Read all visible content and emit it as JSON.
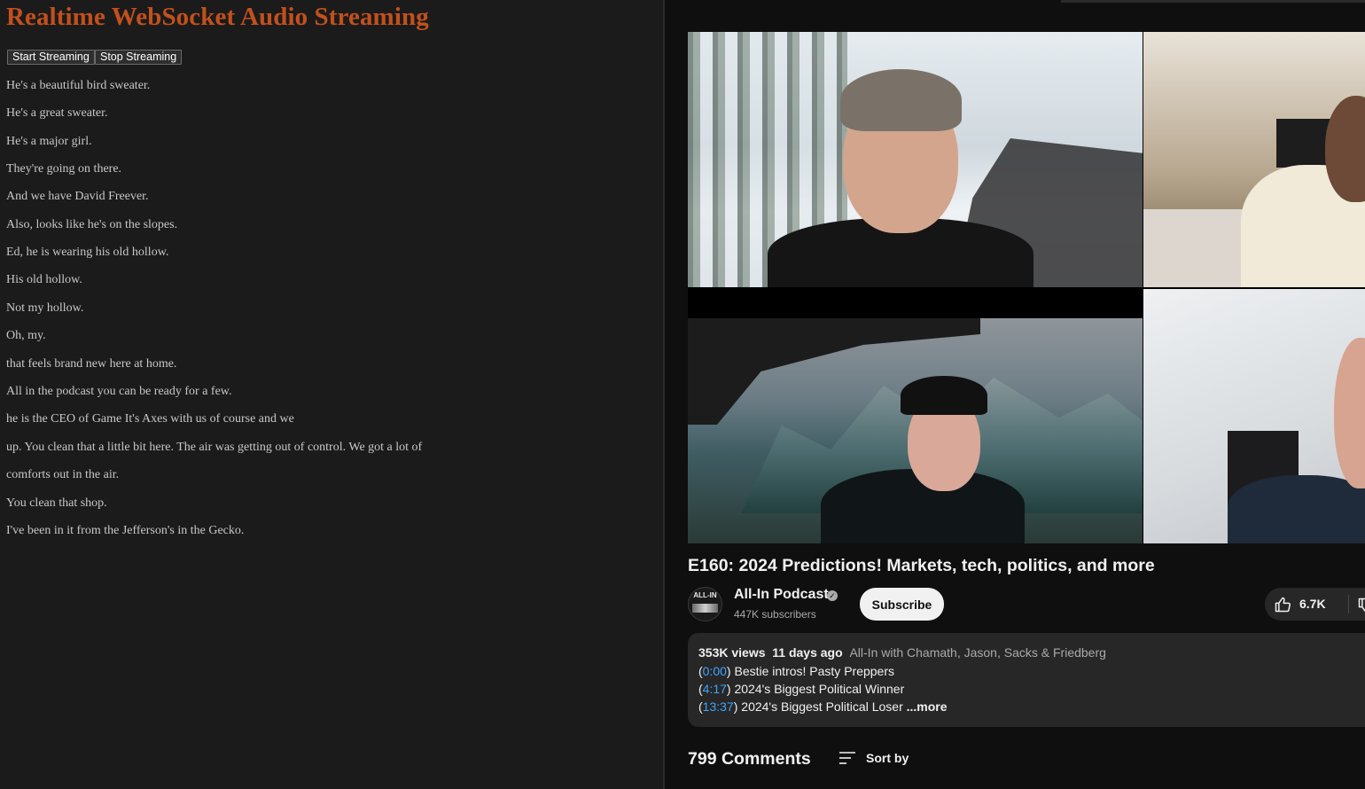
{
  "left_app": {
    "title": "Realtime WebSocket Audio Streaming",
    "start_label": "Start Streaming",
    "stop_label": "Stop Streaming",
    "transcript": [
      "He's a beautiful bird sweater.",
      "He's a great sweater.",
      "He's a major girl.",
      "They're going on there.",
      "And we have David Freever.",
      "Also, looks like he's on the slopes.",
      "Ed, he is wearing his old hollow.",
      "His old hollow.",
      "Not my hollow.",
      "Oh, my.",
      "that feels brand new here at home.",
      "All in the podcast you can be ready for a few.",
      "he is the CEO of Game It's Axes with us of course and we",
      "up. You clean that a little bit here. The air was getting out of control. We got a lot of",
      "comforts out in the air.",
      "You clean that shop.",
      "I've been in it from the Jefferson's in the Gecko."
    ]
  },
  "video_page": {
    "title": "E160: 2024 Predictions! Markets, tech, politics, and more",
    "channel": {
      "avatar_text": "ALL-IN",
      "name": "All-In Podcast",
      "subscribers": "447K subscribers",
      "verified_icon": "✓"
    },
    "subscribe_label": "Subscribe",
    "likes": "6.7K",
    "description": {
      "views": "353K views",
      "age": "11 days ago",
      "hosts": "All-In with Chamath, Jason, Sacks & Friedberg",
      "chapters": [
        {
          "time": "0:00",
          "label": "Bestie intros! Pasty Preppers"
        },
        {
          "time": "4:17",
          "label": "2024's Biggest Political Winner"
        },
        {
          "time": "13:37",
          "label": "2024's Biggest Political Loser"
        }
      ],
      "more_label": "...more"
    },
    "comments_count": "799 Comments",
    "sort_label": "Sort by"
  },
  "colors": {
    "title_orange": "#c2501d",
    "link_blue": "#3ea6ff",
    "youtube_bg": "#0f0f0f",
    "panel_bg": "#1b1b1b"
  }
}
